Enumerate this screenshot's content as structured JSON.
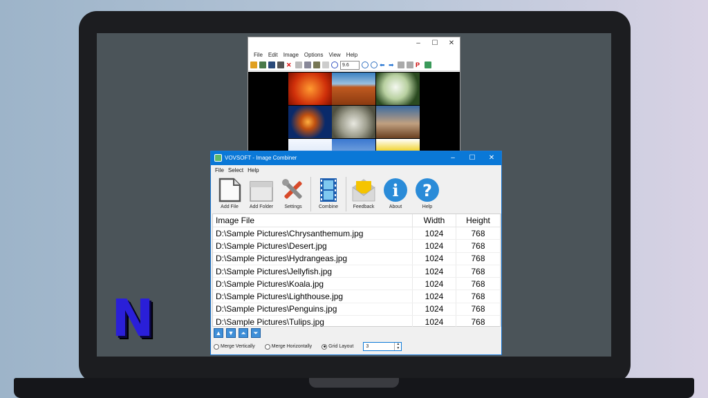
{
  "viewer": {
    "menu": [
      "File",
      "Edit",
      "Image",
      "Options",
      "View",
      "Help"
    ],
    "zoom_value": "9.6",
    "controls": [
      "–",
      "☐",
      "✕"
    ]
  },
  "main": {
    "title": "VOVSOFT - Image Combiner",
    "controls": [
      "–",
      "☐",
      "✕"
    ],
    "menu": [
      "File",
      "Select",
      "Help"
    ],
    "tools": [
      {
        "label": "Add File",
        "icon": "add-file-icon"
      },
      {
        "label": "Add Folder",
        "icon": "add-folder-icon"
      },
      {
        "label": "Settings",
        "icon": "settings-icon"
      },
      {
        "label": "Combine",
        "icon": "film-strip-icon"
      },
      {
        "label": "Feedback",
        "icon": "envelope-icon"
      },
      {
        "label": "About",
        "icon": "info-icon"
      },
      {
        "label": "Help",
        "icon": "question-icon"
      }
    ],
    "table": {
      "columns": [
        "Image File",
        "Width",
        "Height"
      ],
      "rows": [
        [
          "D:\\Sample Pictures\\Chrysanthemum.jpg",
          "1024",
          "768"
        ],
        [
          "D:\\Sample Pictures\\Desert.jpg",
          "1024",
          "768"
        ],
        [
          "D:\\Sample Pictures\\Hydrangeas.jpg",
          "1024",
          "768"
        ],
        [
          "D:\\Sample Pictures\\Jellyfish.jpg",
          "1024",
          "768"
        ],
        [
          "D:\\Sample Pictures\\Koala.jpg",
          "1024",
          "768"
        ],
        [
          "D:\\Sample Pictures\\Lighthouse.jpg",
          "1024",
          "768"
        ],
        [
          "D:\\Sample Pictures\\Penguins.jpg",
          "1024",
          "768"
        ],
        [
          "D:\\Sample Pictures\\Tulips.jpg",
          "1024",
          "768"
        ]
      ]
    },
    "options": {
      "merge_vertically": "Merge Vertically",
      "merge_horizontally": "Merge Horizontally",
      "grid_layout": "Grid Layout",
      "selected": "grid_layout",
      "grid_value": "3"
    }
  },
  "logo_letter": "N"
}
